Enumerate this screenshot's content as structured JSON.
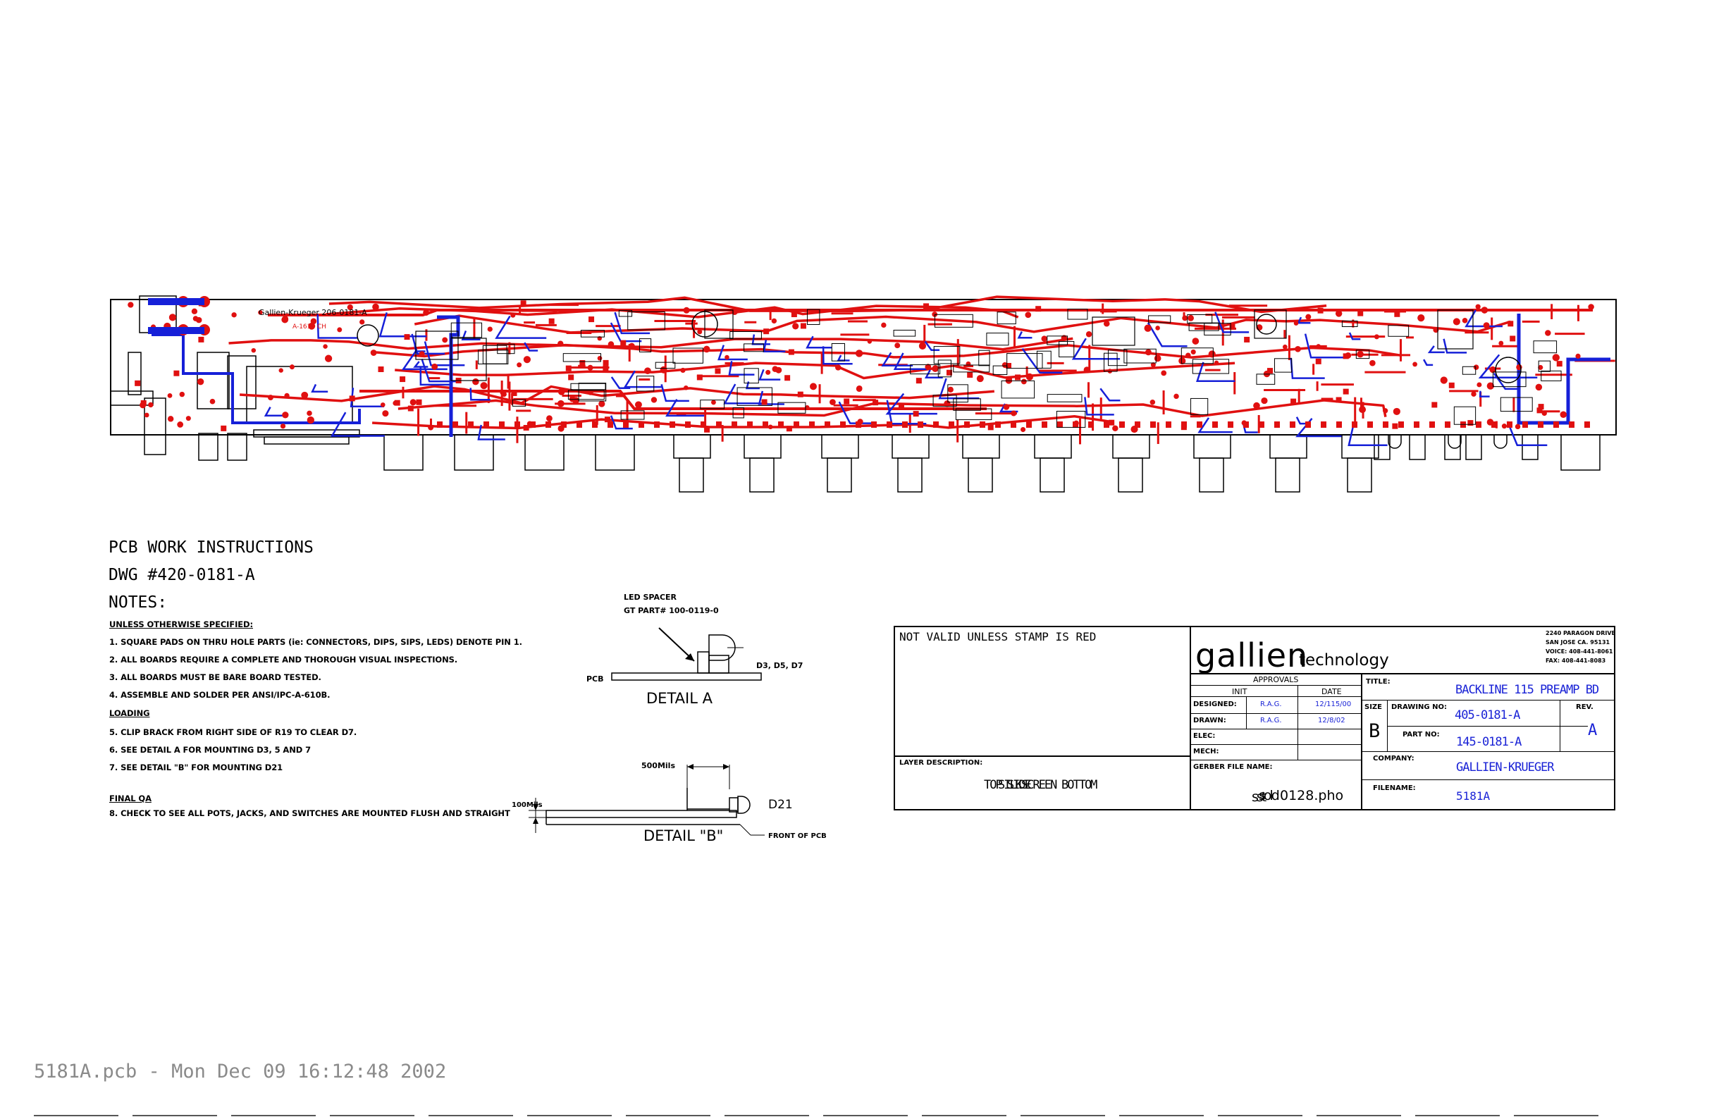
{
  "board": {
    "silkscreen_title": "Gallien-Krueger 206-0181-A",
    "silkscreen_sub": "A-1616 CH",
    "colors": {
      "top": "#e01010",
      "bottom": "#1620d8",
      "silk": "#000000",
      "pad": "#e01010"
    }
  },
  "instructions": {
    "heading": "PCB WORK INSTRUCTIONS",
    "dwg": "DWG #420-0181-A",
    "notes_heading": "NOTES:",
    "unless_heading": "UNLESS OTHERWISE SPECIFIED:",
    "notes": [
      "1. SQUARE PADS ON THRU HOLE PARTS (ie: CONNECTORS, DIPS, SIPS, LEDS) DENOTE PIN 1.",
      "2. ALL BOARDS REQUIRE A COMPLETE AND THOROUGH VISUAL INSPECTIONS.",
      "3. ALL BOARDS MUST BE BARE BOARD TESTED.",
      "4. ASSEMBLE AND SOLDER PER ANSI/IPC-A-610B."
    ],
    "loading_heading": "LOADING",
    "loading": [
      "5. CLIP BRACK FROM RIGHT SIDE OF R19 TO CLEAR D7.",
      "6. SEE DETAIL A FOR MOUNTING D3, 5 AND   7",
      "7. SEE DETAIL \"B\" FOR MOUNTING D21"
    ],
    "final_heading": "FINAL QA",
    "final": [
      "8. CHECK TO SEE ALL POTS, JACKS, AND SWITCHES ARE MOUNTED FLUSH AND STRAIGHT"
    ]
  },
  "detail_a": {
    "spacer_label": "LED SPACER",
    "spacer_part": "GT PART# 100-0119-0",
    "pcb_label": "PCB",
    "leds_label": "D3, D5, D7",
    "caption": "DETAIL A"
  },
  "detail_b": {
    "dim_top": "500Mils",
    "dim_left": "100Mils",
    "led_label": "D21",
    "front_label": "FRONT OF PCB",
    "caption": "DETAIL \"B\""
  },
  "title_block": {
    "stamp_note": "NOT VALID UNLESS STAMP IS RED",
    "brand_main": "gallien",
    "brand_sub": "technology",
    "address": [
      "2240 PARAGON DRIVE",
      "SAN JOSE CA. 95131",
      "VOICE:  408-441-8061",
      "FAX:  408-441-8083"
    ],
    "approvals_label": "APPROVALS",
    "init_label": "INIT",
    "date_label": "DATE",
    "rows": [
      {
        "label": "DESIGNED:",
        "init": "R.A.G.",
        "date": "12/115/00"
      },
      {
        "label": "DRAWN:",
        "init": "R.A.G.",
        "date": "12/8/02"
      },
      {
        "label": "ELEC:",
        "init": "",
        "date": ""
      },
      {
        "label": "MECH:",
        "init": "",
        "date": ""
      }
    ],
    "layer_label": "LAYER DESCRIPTION:",
    "layer_values": [
      "TOP SIDE",
      "SILKSCREEN",
      "BOTTOM"
    ],
    "gerber_label": "GERBER FILE NAME:",
    "gerber_values": [
      "sst",
      "sold",
      "0128.pho"
    ],
    "title_label": "TITLE:",
    "title_value": "BACKLINE 115 PREAMP BD",
    "size_label": "SIZE",
    "size_value": "B",
    "drawing_no_label": "DRAWING NO:",
    "drawing_no_value": "405-0181-A",
    "rev_label": "REV.",
    "rev_value": "A",
    "part_no_label": "PART NO:",
    "part_no_value": "145-0181-A",
    "company_label": "COMPANY:",
    "company_value": "GALLIEN-KRUEGER",
    "filename_label": "FILENAME:",
    "filename_value": "5181A"
  },
  "footer": {
    "text": "5181A.pcb - Mon Dec 09 16:12:48 2002"
  }
}
